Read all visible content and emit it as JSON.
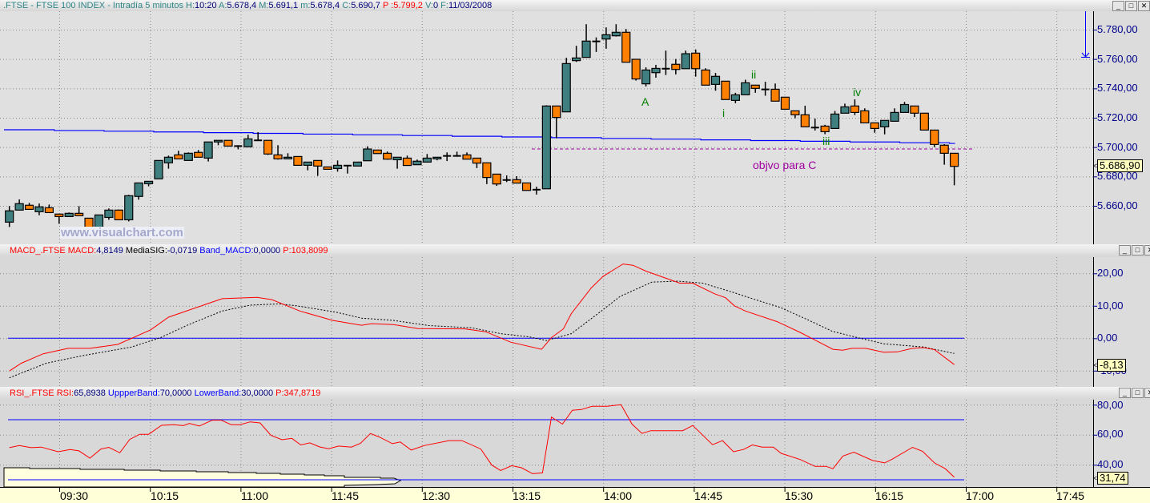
{
  "header": {
    "symbol_title": ".FTSE - FTSE 100 INDEX - Intradía 5 minutos",
    "h_label": "H:",
    "h_value": "10:20",
    "a_label": "A:",
    "a_value": "5.678,4",
    "m_label": "M:",
    "m_value": "5.691,1",
    "mm_label": "m:",
    "mm_value": "5.678,4",
    "c_label": "C:",
    "c_value": "5.690,7",
    "p_label": "P :",
    "p_value": "5.799,2",
    "v_label": "V:",
    "v_value": "0",
    "f_label": "F:",
    "f_value": "11/03/2008"
  },
  "macd_header": {
    "name": "MACD_.FTSE",
    "macd_label": "MACD:",
    "macd_value": "4,8149",
    "sig_label": "MediaSIG:",
    "sig_value": "-0,0719",
    "band_label": "Band_MACD:",
    "band_value": "0,0000",
    "p_label": "P:",
    "p_value": "103,8099"
  },
  "rsi_header": {
    "name": "RSI_.FTSE",
    "rsi_label": "RSI:",
    "rsi_value": "65,8938",
    "upper_label": "UppperBand:",
    "upper_value": "70,0000",
    "lower_label": "LowerBand:",
    "lower_value": "30,0000",
    "p_label": "P:",
    "p_value": "347,8719"
  },
  "window_buttons": {
    "minimize": "_",
    "maximize": "□",
    "close": "✕"
  },
  "price_axis": [
    "5.780,00",
    "5.760,00",
    "5.740,00",
    "5.720,00",
    "5.700,00",
    "5.680,00",
    "5.660,00"
  ],
  "macd_axis": [
    "20,00",
    "10,00",
    "0,00",
    "-10,00"
  ],
  "rsi_axis": [
    "80,00",
    "60,00",
    "40,00"
  ],
  "last_values": {
    "price": "5.686,90",
    "macd": "-8,13",
    "rsi": "31,74"
  },
  "time_axis": [
    "09:30",
    "10:15",
    "11:00",
    "11:45",
    "12:30",
    "13:15",
    "14:00",
    "14:45",
    "15:30",
    "16:15",
    "17:00",
    "17:45"
  ],
  "annotations": {
    "A": "A",
    "i": "i",
    "ii": "ii",
    "iii": "iii",
    "iv": "iv",
    "target": "objvo para C"
  },
  "watermark": "www.visualchart.com",
  "colors": {
    "up": "#3f7f7f",
    "down": "#ff8000",
    "macd": "#ff0000",
    "signal": "#000000",
    "band": "#0000ff",
    "rsi": "#ff0000",
    "target": "#a000a0",
    "wave": "#008000"
  },
  "chart_data": {
    "type": "candlestick",
    "interval": "5 minutos",
    "first_bar_time": "09:05",
    "ylim": [
      5640,
      5790
    ],
    "ohlc": [
      [
        5648.9,
        5659.8,
        5645.6,
        5656.6
      ],
      [
        5657.1,
        5664.4,
        5657.1,
        5661.5
      ],
      [
        5660.4,
        5662,
        5657.6,
        5657.6
      ],
      [
        5656,
        5661.6,
        5653.6,
        5659.3
      ],
      [
        5658.7,
        5660.9,
        5655.4,
        5655.4
      ],
      [
        5654.4,
        5654.4,
        5647.8,
        5652.7
      ],
      [
        5652.7,
        5655.5,
        5652.7,
        5654.9
      ],
      [
        5654.9,
        5659.8,
        5653.3,
        5653.3
      ],
      [
        5651.6,
        5651.6,
        5645,
        5645.5
      ],
      [
        5645.5,
        5654,
        5645,
        5653.8
      ],
      [
        5652.1,
        5658.2,
        5650.5,
        5657.1
      ],
      [
        5657.1,
        5657.5,
        5650.5,
        5650.5
      ],
      [
        5650.5,
        5667.5,
        5649.4,
        5666.9
      ],
      [
        5666.4,
        5675.6,
        5664.2,
        5675.6
      ],
      [
        5675.1,
        5676.7,
        5673.3,
        5676.7
      ],
      [
        5678.4,
        5690.9,
        5678.4,
        5690.9
      ],
      [
        5689.3,
        5694.2,
        5685.3,
        5693.1
      ],
      [
        5694.7,
        5697.5,
        5692,
        5692
      ],
      [
        5690.9,
        5696.4,
        5690.9,
        5695.8
      ],
      [
        5696.4,
        5698,
        5693.1,
        5693.1
      ],
      [
        5692.5,
        5703.5,
        5690.2,
        5703.5
      ],
      [
        5703.5,
        5704.6,
        5701.3,
        5704.6
      ],
      [
        5704.6,
        5704.6,
        5700.7,
        5700.7
      ],
      [
        5700.7,
        5701.3,
        5698.5,
        5700.2
      ],
      [
        5700.2,
        5708.4,
        5700.2,
        5705.6
      ],
      [
        5704.6,
        5710.2,
        5704.6,
        5704.6
      ],
      [
        5704.6,
        5704.6,
        5694.7,
        5695.3
      ],
      [
        5694.7,
        5701.3,
        5691.5,
        5692
      ],
      [
        5692,
        5695.8,
        5692,
        5693.1
      ],
      [
        5693.6,
        5693.6,
        5687.6,
        5687.6
      ],
      [
        5687.6,
        5689.8,
        5684.2,
        5689.8
      ],
      [
        5690.9,
        5690.9,
        5680.4,
        5687.1
      ],
      [
        5686.5,
        5686.5,
        5684.9,
        5684.9
      ],
      [
        5685.4,
        5690.9,
        5683.3,
        5687.6
      ],
      [
        5687.4,
        5687.4,
        5682,
        5687.4
      ],
      [
        5687.1,
        5689.8,
        5687.1,
        5689.8
      ],
      [
        5690.7,
        5700.5,
        5690.7,
        5698.7
      ],
      [
        5698,
        5698,
        5695.6,
        5695.6
      ],
      [
        5695.8,
        5697,
        5691.4,
        5691.8
      ],
      [
        5691.4,
        5693.1,
        5685.3,
        5693.1
      ],
      [
        5692.5,
        5694.2,
        5687.5,
        5687.5
      ],
      [
        5688,
        5691.5,
        5688,
        5690.4
      ],
      [
        5689.8,
        5695.3,
        5689.8,
        5692.5
      ],
      [
        5692,
        5693.1,
        5691,
        5693.1
      ],
      [
        5694,
        5696.4,
        5690.5,
        5694
      ],
      [
        5694,
        5696.9,
        5693.5,
        5694
      ],
      [
        5694.7,
        5696.4,
        5691.8,
        5691.8
      ],
      [
        5692.5,
        5692.5,
        5685.7,
        5689.1
      ],
      [
        5689.3,
        5689.3,
        5674.8,
        5679.3
      ],
      [
        5681.6,
        5681.6,
        5673.6,
        5674.9
      ],
      [
        5677.6,
        5680.7,
        5676.2,
        5677.6
      ],
      [
        5677.8,
        5680.2,
        5675.5,
        5675.5
      ],
      [
        5675.6,
        5675.6,
        5670.5,
        5670.5
      ],
      [
        5671,
        5673,
        5667.7,
        5671
      ],
      [
        5671.6,
        5728.5,
        5671.6,
        5728
      ],
      [
        5728,
        5728,
        5706,
        5720.2
      ],
      [
        5724,
        5760.8,
        5724,
        5756.9
      ],
      [
        5758.9,
        5769,
        5758,
        5760.7
      ],
      [
        5761.1,
        5783.7,
        5761.1,
        5772.2
      ],
      [
        5772,
        5774.7,
        5764.8,
        5772
      ],
      [
        5773.6,
        5781.5,
        5767,
        5776.5
      ],
      [
        5775.8,
        5783.7,
        5775.3,
        5778.2
      ],
      [
        5778.2,
        5780.4,
        5757.8,
        5757.8
      ],
      [
        5759.8,
        5759.8,
        5745.3,
        5746.4
      ],
      [
        5743.1,
        5754.3,
        5741.3,
        5752.5
      ],
      [
        5750.7,
        5756,
        5747.3,
        5753.6
      ],
      [
        5753.4,
        5765.7,
        5749.1,
        5753.4
      ],
      [
        5756.4,
        5760,
        5749.5,
        5752.9
      ],
      [
        5753.4,
        5765.7,
        5753.4,
        5763.6
      ],
      [
        5764,
        5766.5,
        5748,
        5753.4
      ],
      [
        5752.5,
        5753.7,
        5742.2,
        5742.2
      ],
      [
        5742.7,
        5750.5,
        5738.4,
        5748.2
      ],
      [
        5744.9,
        5744.9,
        5732.4,
        5732.4
      ],
      [
        5731.8,
        5737,
        5729.9,
        5735.6
      ],
      [
        5735.6,
        5745.9,
        5735.6,
        5743.8
      ],
      [
        5742.2,
        5742.2,
        5737,
        5740
      ],
      [
        5739.3,
        5744.5,
        5735,
        5739.3
      ],
      [
        5739.4,
        5743.3,
        5731.3,
        5731.3
      ],
      [
        5734,
        5734,
        5725.8,
        5725.8
      ],
      [
        5724.7,
        5724.7,
        5719.6,
        5722
      ],
      [
        5722,
        5728.2,
        5713.8,
        5713.8
      ],
      [
        5713.3,
        5719.4,
        5711.3,
        5713.3
      ],
      [
        5714.3,
        5715.2,
        5708.8,
        5710.5
      ],
      [
        5712.7,
        5724.6,
        5712.7,
        5722.5
      ],
      [
        5723.1,
        5729.6,
        5723.1,
        5727.4
      ],
      [
        5728,
        5732.5,
        5721.8,
        5723.6
      ],
      [
        5724.7,
        5726.4,
        5716.5,
        5716.5
      ],
      [
        5716.5,
        5716.5,
        5709.8,
        5712.7
      ],
      [
        5713.8,
        5718.2,
        5708.7,
        5718.2
      ],
      [
        5717.6,
        5726.4,
        5717.6,
        5723.6
      ],
      [
        5723.6,
        5730.8,
        5723.6,
        5729
      ],
      [
        5728,
        5728,
        5720.5,
        5723.1
      ],
      [
        5723.1,
        5723.1,
        5711.6,
        5711.6
      ],
      [
        5711.6,
        5711.6,
        5700,
        5701.8
      ],
      [
        5701.3,
        5702,
        5688,
        5695.8
      ],
      [
        5695.8,
        5695.8,
        5674,
        5686.9
      ]
    ],
    "moving_average": {
      "start": 5711.8,
      "end": 5702.5
    },
    "target_level": 5698.7,
    "macd": {
      "ylim": [
        -15,
        25
      ],
      "macd_points": [
        [
          0,
          -10.1
        ],
        [
          1.2,
          -7.7
        ],
        [
          3.4,
          -4.8
        ],
        [
          5.9,
          -3.1
        ],
        [
          8.1,
          -3.1
        ],
        [
          10.9,
          -1.9
        ],
        [
          14.2,
          2.6
        ],
        [
          16,
          6.5
        ],
        [
          19.5,
          10.2
        ],
        [
          21.4,
          12.2
        ],
        [
          24.9,
          12.6
        ],
        [
          26.4,
          11.9
        ],
        [
          29.2,
          8.4
        ],
        [
          32.5,
          5.5
        ],
        [
          35.4,
          4.0
        ],
        [
          36.4,
          4.5
        ],
        [
          38.6,
          4.2
        ],
        [
          41.1,
          3.0
        ],
        [
          45.8,
          2.9
        ],
        [
          47.9,
          2.0
        ],
        [
          50.4,
          -1.2
        ],
        [
          53.5,
          -3.4
        ],
        [
          54.5,
          0.2
        ],
        [
          55.7,
          2.9
        ],
        [
          56.5,
          7.6
        ],
        [
          58.5,
          15.5
        ],
        [
          59.7,
          19.1
        ],
        [
          61.7,
          22.9
        ],
        [
          62.7,
          22.5
        ],
        [
          64,
          20.7
        ],
        [
          67.4,
          17.0
        ],
        [
          68.7,
          17.0
        ],
        [
          70.9,
          13.7
        ],
        [
          72,
          12.5
        ],
        [
          72.9,
          10.0
        ],
        [
          74,
          8.4
        ],
        [
          77.2,
          5.1
        ],
        [
          79.5,
          1.8
        ],
        [
          80.7,
          -0.1
        ],
        [
          82.8,
          -3.4
        ],
        [
          83.8,
          -3.7
        ],
        [
          84.7,
          -3.1
        ],
        [
          86.1,
          -3.1
        ],
        [
          87.9,
          -4.3
        ],
        [
          89.3,
          -4.2
        ],
        [
          90.8,
          -3.1
        ],
        [
          91.9,
          -2.9
        ],
        [
          93,
          -3.5
        ],
        [
          95,
          -8.13
        ]
      ],
      "signal_points": [
        [
          0,
          -12.2
        ],
        [
          3.7,
          -7.7
        ],
        [
          7.3,
          -5.4
        ],
        [
          12.3,
          -2.7
        ],
        [
          15.2,
          0.2
        ],
        [
          18.1,
          4.3
        ],
        [
          21.4,
          8.4
        ],
        [
          24.2,
          10.2
        ],
        [
          27.1,
          10.6
        ],
        [
          28.9,
          10.0
        ],
        [
          32.9,
          8.0
        ],
        [
          35.4,
          6.2
        ],
        [
          38.6,
          5.5
        ],
        [
          42.2,
          3.9
        ],
        [
          46.5,
          3.2
        ],
        [
          49.4,
          1.4
        ],
        [
          52.3,
          0.4
        ],
        [
          54,
          -0.7
        ],
        [
          56.5,
          1.4
        ],
        [
          59.4,
          8.1
        ],
        [
          61.4,
          12.9
        ],
        [
          64.6,
          17.3
        ],
        [
          67.2,
          17.6
        ],
        [
          69.7,
          17.0
        ],
        [
          72.3,
          14.6
        ],
        [
          75.2,
          11.7
        ],
        [
          77.5,
          9.5
        ],
        [
          80.4,
          5.5
        ],
        [
          82.7,
          2.2
        ],
        [
          85,
          0.4
        ],
        [
          87.9,
          -1.7
        ],
        [
          91.9,
          -2.7
        ],
        [
          95,
          -4.7
        ]
      ],
      "band": 0
    },
    "rsi": {
      "ylim": [
        25,
        85
      ],
      "points": [
        [
          0,
          51.4
        ],
        [
          1,
          52.8
        ],
        [
          2.2,
          51.4
        ],
        [
          3.2,
          51.8
        ],
        [
          4.9,
          48.7
        ],
        [
          6.1,
          50.2
        ],
        [
          7,
          49.3
        ],
        [
          8.1,
          44.4
        ],
        [
          9.2,
          50.5
        ],
        [
          10,
          51.6
        ],
        [
          11.1,
          48.0
        ],
        [
          12.1,
          56.9
        ],
        [
          13.1,
          60.3
        ],
        [
          14,
          60.3
        ],
        [
          15.3,
          66.3
        ],
        [
          16.5,
          66.7
        ],
        [
          17.5,
          66.1
        ],
        [
          18.1,
          67.5
        ],
        [
          19.1,
          65.8
        ],
        [
          20.4,
          69.7
        ],
        [
          21.3,
          69.7
        ],
        [
          22.3,
          66.7
        ],
        [
          23.2,
          66.7
        ],
        [
          24.2,
          68.6
        ],
        [
          25.2,
          67.9
        ],
        [
          26.3,
          59.6
        ],
        [
          27.4,
          56.7
        ],
        [
          28.4,
          57.6
        ],
        [
          29.3,
          53.2
        ],
        [
          30.2,
          54.6
        ],
        [
          31.2,
          51.9
        ],
        [
          32.1,
          50.7
        ],
        [
          33.1,
          52.5
        ],
        [
          34.4,
          51.8
        ],
        [
          35.3,
          54.3
        ],
        [
          36.3,
          60.8
        ],
        [
          37.2,
          58.5
        ],
        [
          38.5,
          54.1
        ],
        [
          39.3,
          55.2
        ],
        [
          40.4,
          49.8
        ],
        [
          41.7,
          52.8
        ],
        [
          44.2,
          56.1
        ],
        [
          45.5,
          56.1
        ],
        [
          47.4,
          50.5
        ],
        [
          48.5,
          39.8
        ],
        [
          49.4,
          36.2
        ],
        [
          50.5,
          39.4
        ],
        [
          51.5,
          38.0
        ],
        [
          52.6,
          34.1
        ],
        [
          53.6,
          34.6
        ],
        [
          54.5,
          71.8
        ],
        [
          55.6,
          67.1
        ],
        [
          56.6,
          76.3
        ],
        [
          57.5,
          76.8
        ],
        [
          58.6,
          79.0
        ],
        [
          60.1,
          79.0
        ],
        [
          61.5,
          80.0
        ],
        [
          62.6,
          67.1
        ],
        [
          63.6,
          60.9
        ],
        [
          64.5,
          62.7
        ],
        [
          67.7,
          62.7
        ],
        [
          68.7,
          66.2
        ],
        [
          70.7,
          53.4
        ],
        [
          71.7,
          56.1
        ],
        [
          72.8,
          48.7
        ],
        [
          73.8,
          50.2
        ],
        [
          74.7,
          53.2
        ],
        [
          75.7,
          51.8
        ],
        [
          76.8,
          51.8
        ],
        [
          77.6,
          47.6
        ],
        [
          79.5,
          43.5
        ],
        [
          81,
          39.0
        ],
        [
          82.1,
          39.0
        ],
        [
          82.8,
          37.4
        ],
        [
          83.8,
          45.8
        ],
        [
          84.9,
          48.4
        ],
        [
          86.8,
          42.8
        ],
        [
          88,
          41.3
        ],
        [
          88.7,
          43.5
        ],
        [
          90.8,
          51.6
        ],
        [
          91.8,
          49.0
        ],
        [
          93,
          41.3
        ],
        [
          94.1,
          37.4
        ],
        [
          95,
          31.74
        ]
      ],
      "upper_band": 70,
      "lower_band": 30
    }
  }
}
